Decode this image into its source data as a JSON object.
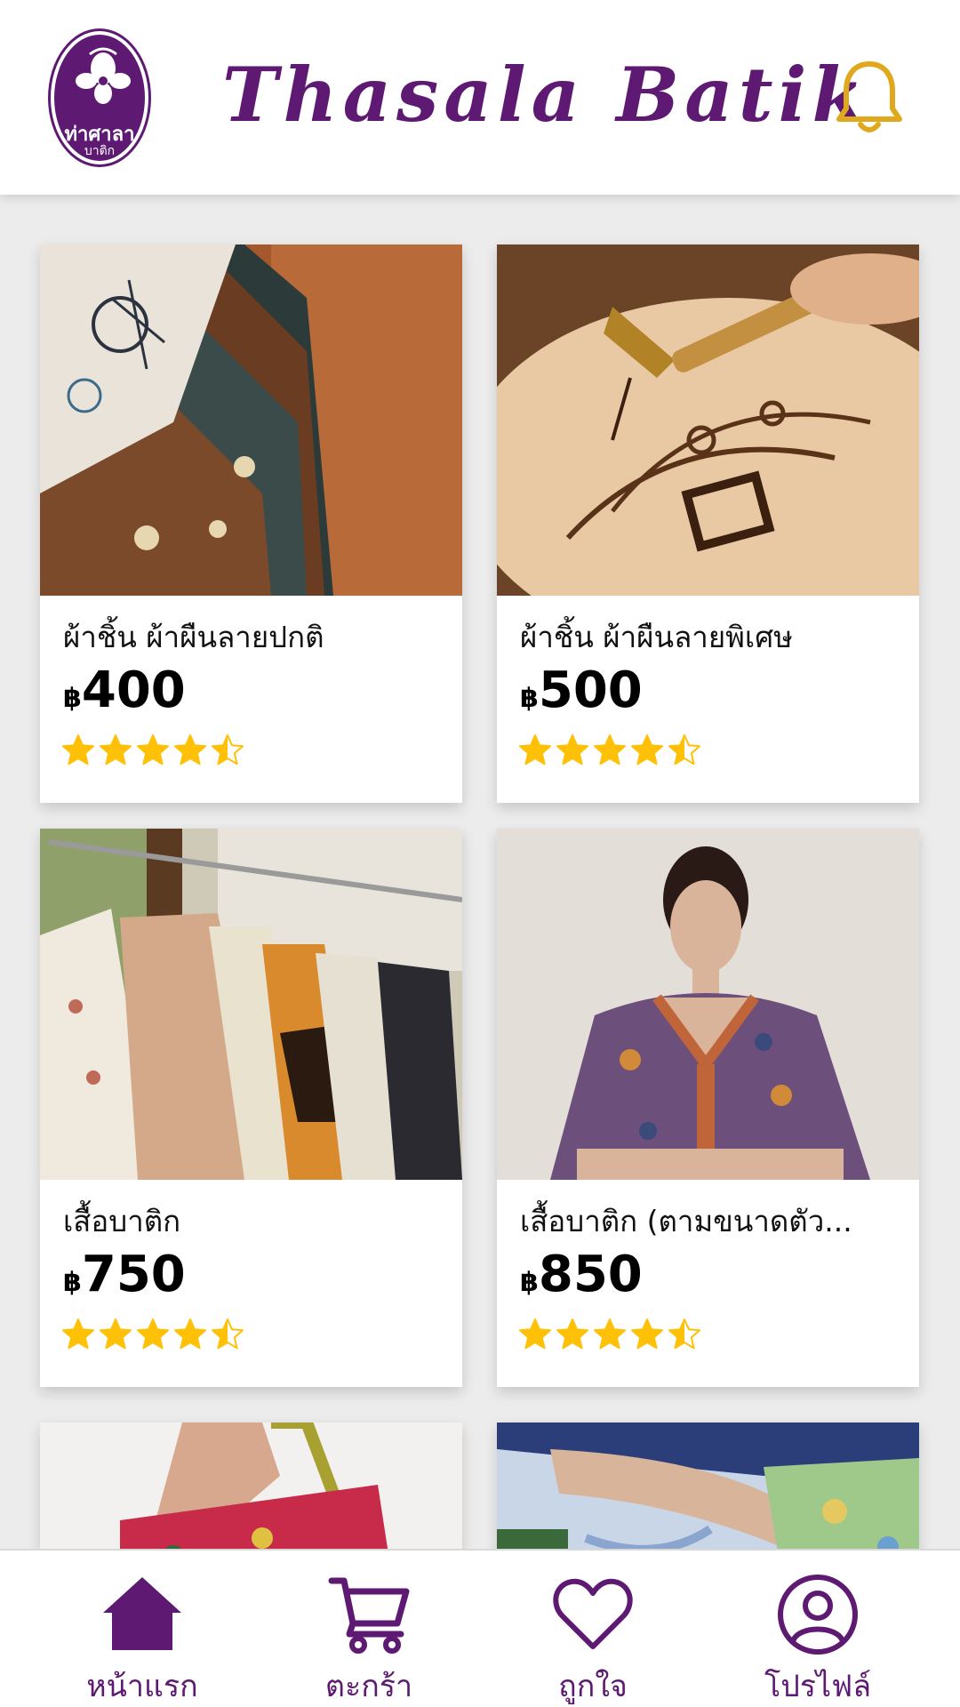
{
  "header": {
    "logo_text": "ท่าศาลา",
    "logo_subtext": "บาติก",
    "title": "Thasala Batik",
    "bell_icon": "bell-icon"
  },
  "colors": {
    "brand_purple": "#5e1a73",
    "bell_gold": "#e0a81c",
    "star_gold": "#ffc107",
    "background": "#ececec"
  },
  "products": [
    {
      "name": "ผ้าชิ้น ผ้าผืนลายปกติ",
      "currency": "฿",
      "price": "400",
      "rating": 4.5
    },
    {
      "name": "ผ้าชิ้น ผ้าผืนลายพิเศษ",
      "currency": "฿",
      "price": "500",
      "rating": 4.5
    },
    {
      "name": "เสื้อบาติก",
      "currency": "฿",
      "price": "750",
      "rating": 4.5
    },
    {
      "name": "เสื้อบาติก (ตามขนาดตัว...",
      "currency": "฿",
      "price": "850",
      "rating": 4.5
    }
  ],
  "nav": [
    {
      "label": "หน้าแรก",
      "icon": "home-icon",
      "active": true
    },
    {
      "label": "ตะกร้า",
      "icon": "cart-icon",
      "active": false
    },
    {
      "label": "ถูกใจ",
      "icon": "heart-icon",
      "active": false
    },
    {
      "label": "โปรไฟล์",
      "icon": "profile-icon",
      "active": false
    }
  ]
}
